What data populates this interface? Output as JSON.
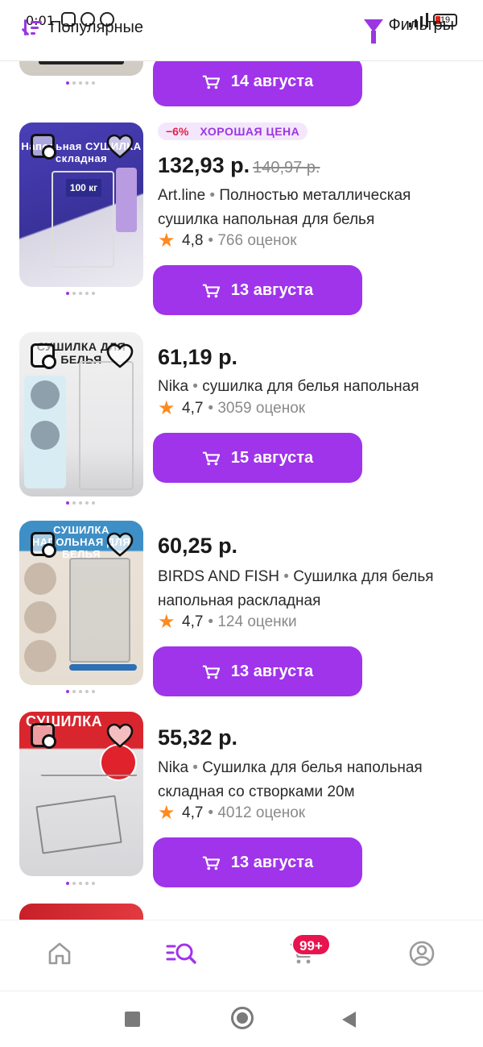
{
  "status_bar": {
    "time": "0:01",
    "battery": "19"
  },
  "header": {
    "sort_label": "Популярные",
    "filter_label": "Фильтры"
  },
  "colors": {
    "accent": "#9f34ea",
    "discount": "#e0214b",
    "badge_bg": "#f4e7fb",
    "star": "#ff8a1f",
    "cart_badge": "#e8144f"
  },
  "prev_item": {
    "delivery_label": "14 августа"
  },
  "products": [
    {
      "discount": "−6%",
      "badge": "ХОРОШАЯ ЦЕНА",
      "price": "132,93 р.",
      "old_price": "140,97 р.",
      "brand": "Art.line",
      "separator": " • ",
      "name": "Полностью металлическая сушилка напольная для белья",
      "rating": "4,8",
      "reviews": "766 оценок",
      "delivery_label": "13 августа",
      "image_text": "Напольная СУШИЛКА складная"
    },
    {
      "price": "61,19 р.",
      "brand": "Nika",
      "separator": " • ",
      "name": "сушилка для белья напольная",
      "rating": "4,7",
      "reviews": "3059 оценок",
      "delivery_label": "15 августа",
      "image_text": "СУШИЛКА ДЛЯ БЕЛЬЯ"
    },
    {
      "price": "60,25 р.",
      "brand": "BIRDS AND FISH",
      "separator": " • ",
      "name": "Сушилка для белья напольная раскладная",
      "rating": "4,7",
      "reviews": "124 оценки",
      "delivery_label": "13 августа",
      "image_text": "СУШИЛКА НАПОЛЬНАЯ ДЛЯ БЕЛЬЯ"
    },
    {
      "price": "55,32 р.",
      "brand": "Nika",
      "separator": " • ",
      "name": "Сушилка для белья напольная складная со створками 20м",
      "rating": "4,7",
      "reviews": "4012 оценок",
      "delivery_label": "13 августа",
      "image_text": "СУШИЛКА"
    }
  ],
  "bottom_nav": {
    "items": [
      "home-icon",
      "catalog-search-icon",
      "cart-icon",
      "profile-icon"
    ],
    "cart_badge": "99+"
  }
}
